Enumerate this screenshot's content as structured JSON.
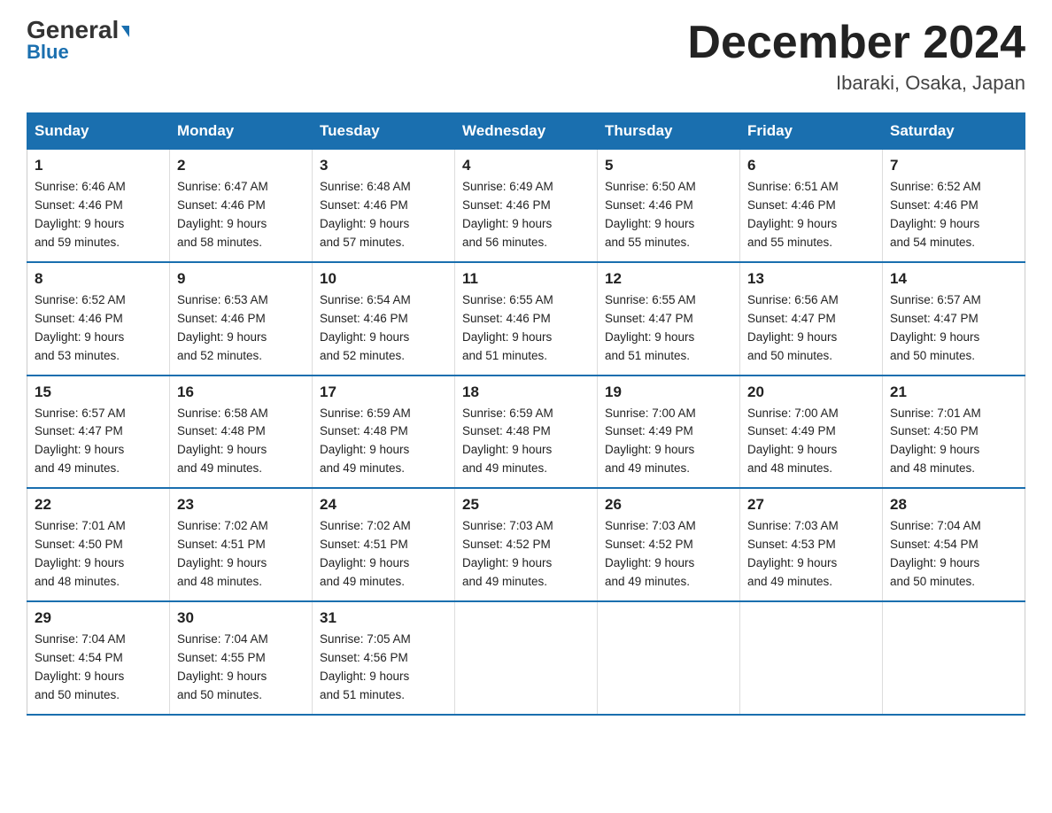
{
  "logo": {
    "text1": "General",
    "triangle": "▶",
    "text2": "Blue"
  },
  "title": "December 2024",
  "subtitle": "Ibaraki, Osaka, Japan",
  "weekdays": [
    "Sunday",
    "Monday",
    "Tuesday",
    "Wednesday",
    "Thursday",
    "Friday",
    "Saturday"
  ],
  "weeks": [
    [
      {
        "day": "1",
        "sunrise": "6:46 AM",
        "sunset": "4:46 PM",
        "daylight": "9 hours and 59 minutes."
      },
      {
        "day": "2",
        "sunrise": "6:47 AM",
        "sunset": "4:46 PM",
        "daylight": "9 hours and 58 minutes."
      },
      {
        "day": "3",
        "sunrise": "6:48 AM",
        "sunset": "4:46 PM",
        "daylight": "9 hours and 57 minutes."
      },
      {
        "day": "4",
        "sunrise": "6:49 AM",
        "sunset": "4:46 PM",
        "daylight": "9 hours and 56 minutes."
      },
      {
        "day": "5",
        "sunrise": "6:50 AM",
        "sunset": "4:46 PM",
        "daylight": "9 hours and 55 minutes."
      },
      {
        "day": "6",
        "sunrise": "6:51 AM",
        "sunset": "4:46 PM",
        "daylight": "9 hours and 55 minutes."
      },
      {
        "day": "7",
        "sunrise": "6:52 AM",
        "sunset": "4:46 PM",
        "daylight": "9 hours and 54 minutes."
      }
    ],
    [
      {
        "day": "8",
        "sunrise": "6:52 AM",
        "sunset": "4:46 PM",
        "daylight": "9 hours and 53 minutes."
      },
      {
        "day": "9",
        "sunrise": "6:53 AM",
        "sunset": "4:46 PM",
        "daylight": "9 hours and 52 minutes."
      },
      {
        "day": "10",
        "sunrise": "6:54 AM",
        "sunset": "4:46 PM",
        "daylight": "9 hours and 52 minutes."
      },
      {
        "day": "11",
        "sunrise": "6:55 AM",
        "sunset": "4:46 PM",
        "daylight": "9 hours and 51 minutes."
      },
      {
        "day": "12",
        "sunrise": "6:55 AM",
        "sunset": "4:47 PM",
        "daylight": "9 hours and 51 minutes."
      },
      {
        "day": "13",
        "sunrise": "6:56 AM",
        "sunset": "4:47 PM",
        "daylight": "9 hours and 50 minutes."
      },
      {
        "day": "14",
        "sunrise": "6:57 AM",
        "sunset": "4:47 PM",
        "daylight": "9 hours and 50 minutes."
      }
    ],
    [
      {
        "day": "15",
        "sunrise": "6:57 AM",
        "sunset": "4:47 PM",
        "daylight": "9 hours and 49 minutes."
      },
      {
        "day": "16",
        "sunrise": "6:58 AM",
        "sunset": "4:48 PM",
        "daylight": "9 hours and 49 minutes."
      },
      {
        "day": "17",
        "sunrise": "6:59 AM",
        "sunset": "4:48 PM",
        "daylight": "9 hours and 49 minutes."
      },
      {
        "day": "18",
        "sunrise": "6:59 AM",
        "sunset": "4:48 PM",
        "daylight": "9 hours and 49 minutes."
      },
      {
        "day": "19",
        "sunrise": "7:00 AM",
        "sunset": "4:49 PM",
        "daylight": "9 hours and 49 minutes."
      },
      {
        "day": "20",
        "sunrise": "7:00 AM",
        "sunset": "4:49 PM",
        "daylight": "9 hours and 48 minutes."
      },
      {
        "day": "21",
        "sunrise": "7:01 AM",
        "sunset": "4:50 PM",
        "daylight": "9 hours and 48 minutes."
      }
    ],
    [
      {
        "day": "22",
        "sunrise": "7:01 AM",
        "sunset": "4:50 PM",
        "daylight": "9 hours and 48 minutes."
      },
      {
        "day": "23",
        "sunrise": "7:02 AM",
        "sunset": "4:51 PM",
        "daylight": "9 hours and 48 minutes."
      },
      {
        "day": "24",
        "sunrise": "7:02 AM",
        "sunset": "4:51 PM",
        "daylight": "9 hours and 49 minutes."
      },
      {
        "day": "25",
        "sunrise": "7:03 AM",
        "sunset": "4:52 PM",
        "daylight": "9 hours and 49 minutes."
      },
      {
        "day": "26",
        "sunrise": "7:03 AM",
        "sunset": "4:52 PM",
        "daylight": "9 hours and 49 minutes."
      },
      {
        "day": "27",
        "sunrise": "7:03 AM",
        "sunset": "4:53 PM",
        "daylight": "9 hours and 49 minutes."
      },
      {
        "day": "28",
        "sunrise": "7:04 AM",
        "sunset": "4:54 PM",
        "daylight": "9 hours and 50 minutes."
      }
    ],
    [
      {
        "day": "29",
        "sunrise": "7:04 AM",
        "sunset": "4:54 PM",
        "daylight": "9 hours and 50 minutes."
      },
      {
        "day": "30",
        "sunrise": "7:04 AM",
        "sunset": "4:55 PM",
        "daylight": "9 hours and 50 minutes."
      },
      {
        "day": "31",
        "sunrise": "7:05 AM",
        "sunset": "4:56 PM",
        "daylight": "9 hours and 51 minutes."
      },
      null,
      null,
      null,
      null
    ]
  ],
  "labels": {
    "sunrise": "Sunrise:",
    "sunset": "Sunset:",
    "daylight": "Daylight:"
  }
}
